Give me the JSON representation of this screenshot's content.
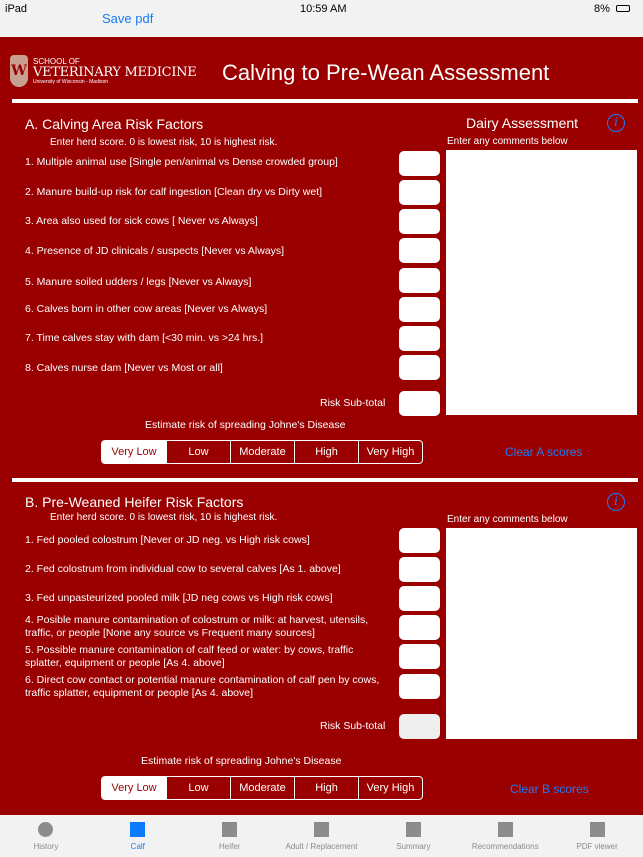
{
  "status": {
    "device": "iPad",
    "time": "10:59 AM",
    "battery": "8%"
  },
  "nav": {
    "save_label": "Save pdf"
  },
  "logo": {
    "line1": "SCHOOL OF",
    "line2": "VETERINARY MEDICINE",
    "line3": "University of Wisconsin - Madison",
    "mark": "W"
  },
  "title": "Calving to Pre-Wean Assessment",
  "dairy_label": "Dairy Assessment",
  "sectionA": {
    "title": "A. Calving Area Risk Factors",
    "subtitle": "Enter herd score. 0 is lowest risk, 10 is highest risk.",
    "comments_label": "Enter any comments below",
    "items": [
      "1. Multiple animal use [Single pen/animal vs Dense crowded group]",
      "2. Manure build-up risk for calf ingestion [Clean dry vs Dirty wet]",
      "3. Area also used for sick cows [ Never vs Always]",
      "4. Presence of JD clinicals / suspects [Never vs Always]",
      "5. Manure soiled udders / legs [Never vs Always]",
      "6. Calves born in other cow areas [Never vs Always]",
      "7. Time calves stay with dam [<30 min. vs >24 hrs.]",
      "8. Calves nurse dam [Never vs Most or all]"
    ],
    "subtotal_label": "Risk Sub-total",
    "estimate_label": "Estimate risk of spreading Johne's Disease",
    "clear_label": "Clear A scores"
  },
  "sectionB": {
    "title": "B. Pre-Weaned Heifer Risk Factors",
    "subtitle": "Enter herd score. 0 is lowest risk, 10 is highest risk.",
    "comments_label": "Enter any comments below",
    "items": [
      "1. Fed pooled colostrum [Never or JD neg. vs High risk cows]",
      "2. Fed colostrum from individual cow to several calves [As 1. above]",
      "3. Fed unpasteurized pooled milk [JD neg cows vs High risk cows]",
      "4. Posible manure contamination of colostrum or milk: at harvest, utensils, traffic, or people [None any source vs Frequent many sources]",
      "5. Possible manure contamination of calf feed or water: by cows, traffic splatter, equipment or people [As 4. above]",
      "6. Direct cow contact or potential manure contamination of calf pen by cows, traffic splatter, equipment or people [As 4. above]"
    ],
    "subtotal_label": "Risk Sub-total",
    "estimate_label": "Estimate risk of spreading Johne's Disease",
    "clear_label": "Clear B scores"
  },
  "risk_options": [
    "Very Low",
    "Low",
    "Moderate",
    "High",
    "Very High"
  ],
  "selected_risk": "Very Low",
  "tabs": [
    {
      "label": "History",
      "icon": "circle"
    },
    {
      "label": "Calf",
      "icon": "square"
    },
    {
      "label": "Heifer",
      "icon": "square"
    },
    {
      "label": "Adult / Replacement",
      "icon": "square"
    },
    {
      "label": "Summary",
      "icon": "square"
    },
    {
      "label": "Recommendations",
      "icon": "square"
    },
    {
      "label": "PDF viewer",
      "icon": "square"
    }
  ],
  "active_tab": "Calf",
  "colors": {
    "brand": "#9b0000",
    "accent": "#1a7cf5"
  }
}
